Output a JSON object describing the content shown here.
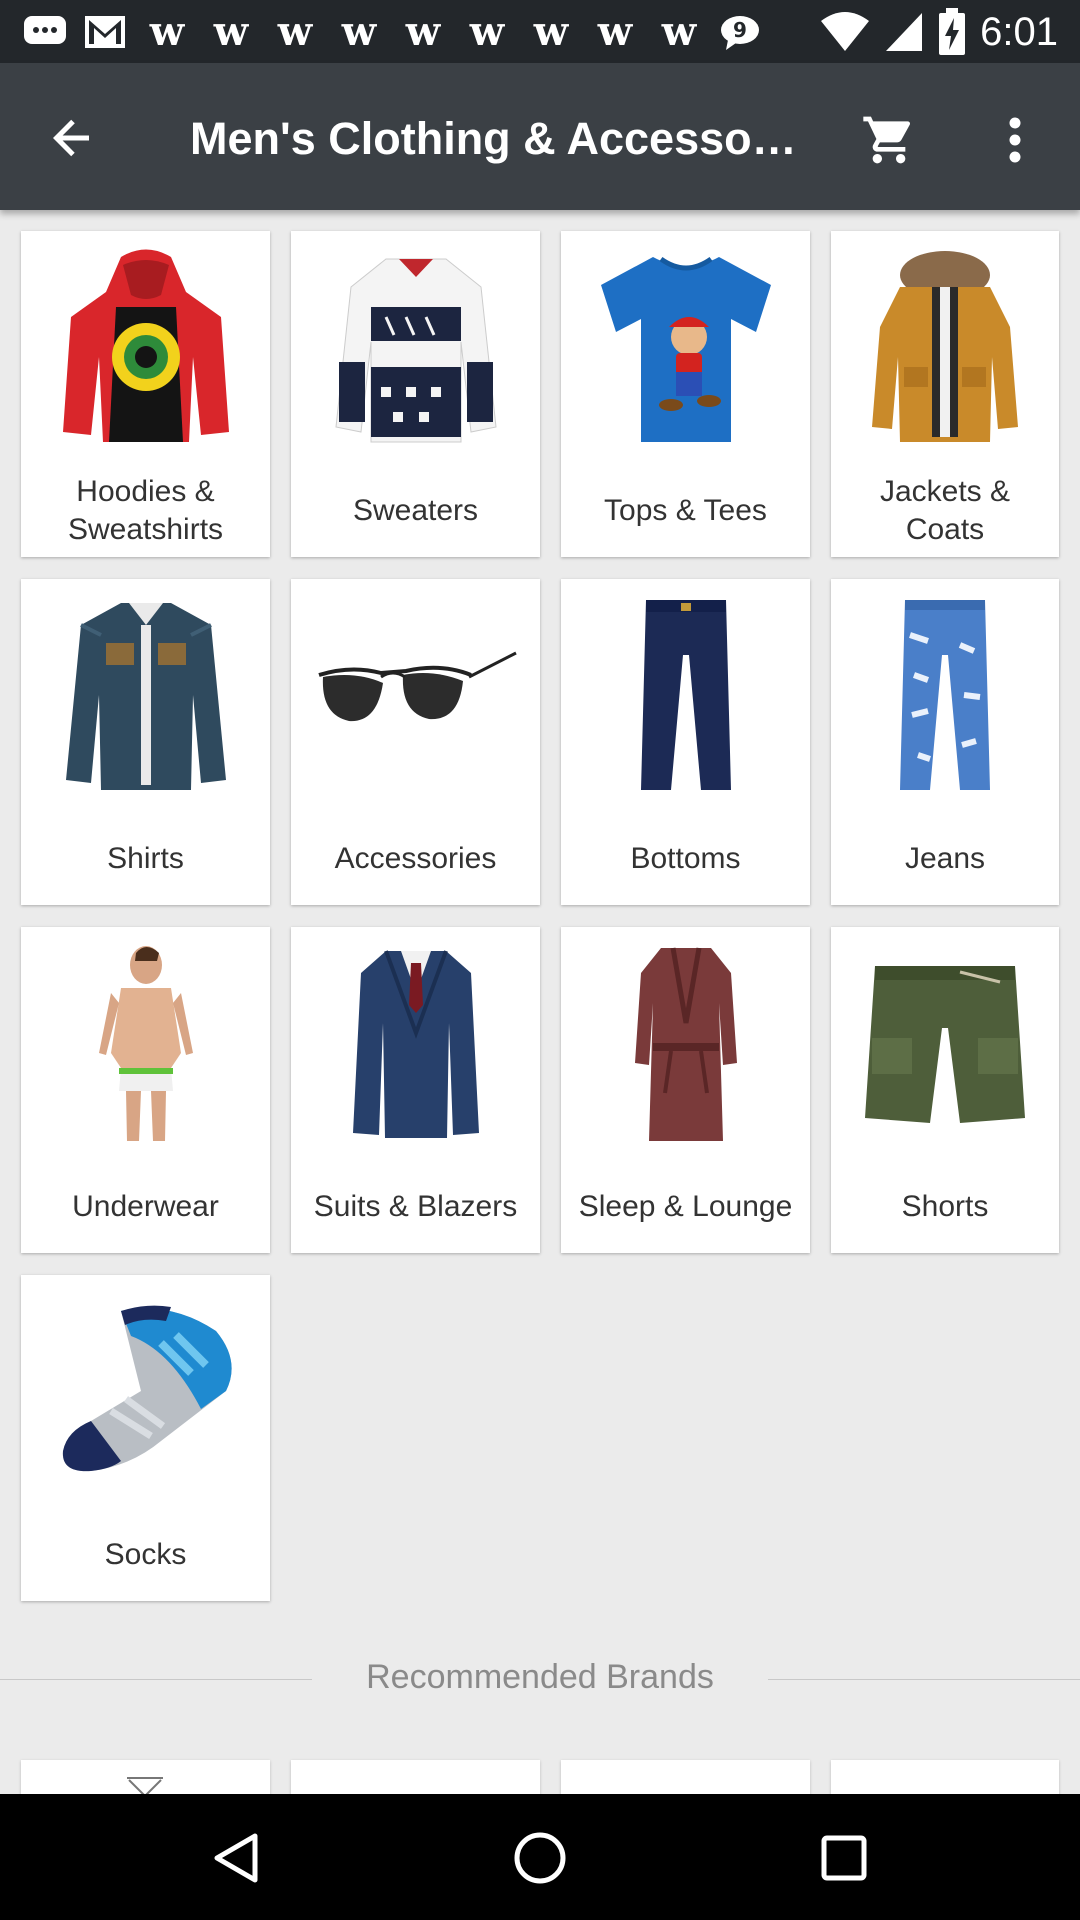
{
  "status_bar": {
    "time": "6:01",
    "notification_icons": [
      "messages-icon",
      "gmail-icon",
      "w-icon",
      "w-icon",
      "w-icon",
      "w-icon",
      "w-icon",
      "w-icon",
      "w-icon",
      "w-icon",
      "w-icon",
      "chat-icon"
    ]
  },
  "app_bar": {
    "title": "Men's Clothing & Accessories",
    "colors": {
      "background": "#3b4045",
      "text": "#ffffff"
    }
  },
  "categories": [
    {
      "label": "Hoodies & Sweatshirts",
      "icon": "hoodie-icon"
    },
    {
      "label": "Sweaters",
      "icon": "sweater-icon"
    },
    {
      "label": "Tops & Tees",
      "icon": "tshirt-icon"
    },
    {
      "label": "Jackets & Coats",
      "icon": "jacket-icon"
    },
    {
      "label": "Shirts",
      "icon": "denim-shirt-icon"
    },
    {
      "label": "Accessories",
      "icon": "sunglasses-icon"
    },
    {
      "label": "Bottoms",
      "icon": "pants-icon"
    },
    {
      "label": "Jeans",
      "icon": "jeans-icon"
    },
    {
      "label": "Underwear",
      "icon": "underwear-icon"
    },
    {
      "label": "Suits & Blazers",
      "icon": "suit-icon"
    },
    {
      "label": "Sleep & Lounge",
      "icon": "robe-icon"
    },
    {
      "label": "Shorts",
      "icon": "shorts-icon"
    },
    {
      "label": "Socks",
      "icon": "sock-icon"
    }
  ],
  "recommended": {
    "title": "Recommended Brands"
  }
}
